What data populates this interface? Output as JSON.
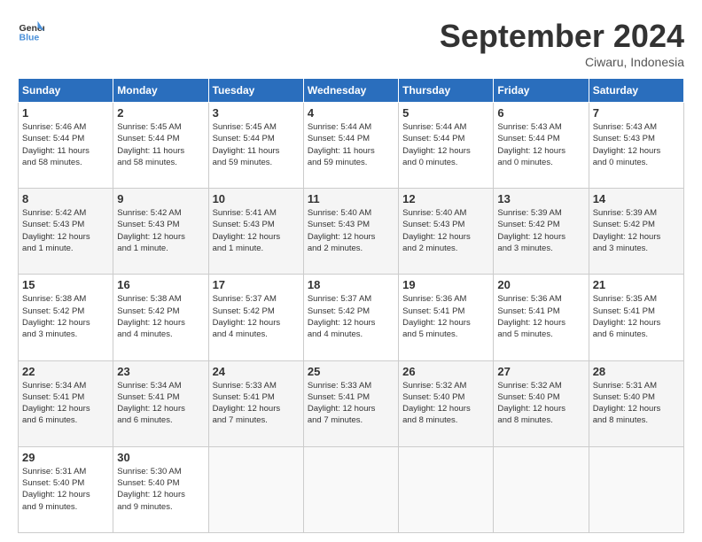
{
  "header": {
    "logo_line1": "General",
    "logo_line2": "Blue",
    "month_title": "September 2024",
    "location": "Ciwaru, Indonesia"
  },
  "weekdays": [
    "Sunday",
    "Monday",
    "Tuesday",
    "Wednesday",
    "Thursday",
    "Friday",
    "Saturday"
  ],
  "weeks": [
    [
      {
        "day": "1",
        "info": "Sunrise: 5:46 AM\nSunset: 5:44 PM\nDaylight: 11 hours\nand 58 minutes."
      },
      {
        "day": "2",
        "info": "Sunrise: 5:45 AM\nSunset: 5:44 PM\nDaylight: 11 hours\nand 58 minutes."
      },
      {
        "day": "3",
        "info": "Sunrise: 5:45 AM\nSunset: 5:44 PM\nDaylight: 11 hours\nand 59 minutes."
      },
      {
        "day": "4",
        "info": "Sunrise: 5:44 AM\nSunset: 5:44 PM\nDaylight: 11 hours\nand 59 minutes."
      },
      {
        "day": "5",
        "info": "Sunrise: 5:44 AM\nSunset: 5:44 PM\nDaylight: 12 hours\nand 0 minutes."
      },
      {
        "day": "6",
        "info": "Sunrise: 5:43 AM\nSunset: 5:44 PM\nDaylight: 12 hours\nand 0 minutes."
      },
      {
        "day": "7",
        "info": "Sunrise: 5:43 AM\nSunset: 5:43 PM\nDaylight: 12 hours\nand 0 minutes."
      }
    ],
    [
      {
        "day": "8",
        "info": "Sunrise: 5:42 AM\nSunset: 5:43 PM\nDaylight: 12 hours\nand 1 minute."
      },
      {
        "day": "9",
        "info": "Sunrise: 5:42 AM\nSunset: 5:43 PM\nDaylight: 12 hours\nand 1 minute."
      },
      {
        "day": "10",
        "info": "Sunrise: 5:41 AM\nSunset: 5:43 PM\nDaylight: 12 hours\nand 1 minute."
      },
      {
        "day": "11",
        "info": "Sunrise: 5:40 AM\nSunset: 5:43 PM\nDaylight: 12 hours\nand 2 minutes."
      },
      {
        "day": "12",
        "info": "Sunrise: 5:40 AM\nSunset: 5:43 PM\nDaylight: 12 hours\nand 2 minutes."
      },
      {
        "day": "13",
        "info": "Sunrise: 5:39 AM\nSunset: 5:42 PM\nDaylight: 12 hours\nand 3 minutes."
      },
      {
        "day": "14",
        "info": "Sunrise: 5:39 AM\nSunset: 5:42 PM\nDaylight: 12 hours\nand 3 minutes."
      }
    ],
    [
      {
        "day": "15",
        "info": "Sunrise: 5:38 AM\nSunset: 5:42 PM\nDaylight: 12 hours\nand 3 minutes."
      },
      {
        "day": "16",
        "info": "Sunrise: 5:38 AM\nSunset: 5:42 PM\nDaylight: 12 hours\nand 4 minutes."
      },
      {
        "day": "17",
        "info": "Sunrise: 5:37 AM\nSunset: 5:42 PM\nDaylight: 12 hours\nand 4 minutes."
      },
      {
        "day": "18",
        "info": "Sunrise: 5:37 AM\nSunset: 5:42 PM\nDaylight: 12 hours\nand 4 minutes."
      },
      {
        "day": "19",
        "info": "Sunrise: 5:36 AM\nSunset: 5:41 PM\nDaylight: 12 hours\nand 5 minutes."
      },
      {
        "day": "20",
        "info": "Sunrise: 5:36 AM\nSunset: 5:41 PM\nDaylight: 12 hours\nand 5 minutes."
      },
      {
        "day": "21",
        "info": "Sunrise: 5:35 AM\nSunset: 5:41 PM\nDaylight: 12 hours\nand 6 minutes."
      }
    ],
    [
      {
        "day": "22",
        "info": "Sunrise: 5:34 AM\nSunset: 5:41 PM\nDaylight: 12 hours\nand 6 minutes."
      },
      {
        "day": "23",
        "info": "Sunrise: 5:34 AM\nSunset: 5:41 PM\nDaylight: 12 hours\nand 6 minutes."
      },
      {
        "day": "24",
        "info": "Sunrise: 5:33 AM\nSunset: 5:41 PM\nDaylight: 12 hours\nand 7 minutes."
      },
      {
        "day": "25",
        "info": "Sunrise: 5:33 AM\nSunset: 5:41 PM\nDaylight: 12 hours\nand 7 minutes."
      },
      {
        "day": "26",
        "info": "Sunrise: 5:32 AM\nSunset: 5:40 PM\nDaylight: 12 hours\nand 8 minutes."
      },
      {
        "day": "27",
        "info": "Sunrise: 5:32 AM\nSunset: 5:40 PM\nDaylight: 12 hours\nand 8 minutes."
      },
      {
        "day": "28",
        "info": "Sunrise: 5:31 AM\nSunset: 5:40 PM\nDaylight: 12 hours\nand 8 minutes."
      }
    ],
    [
      {
        "day": "29",
        "info": "Sunrise: 5:31 AM\nSunset: 5:40 PM\nDaylight: 12 hours\nand 9 minutes."
      },
      {
        "day": "30",
        "info": "Sunrise: 5:30 AM\nSunset: 5:40 PM\nDaylight: 12 hours\nand 9 minutes."
      },
      {
        "day": "",
        "info": ""
      },
      {
        "day": "",
        "info": ""
      },
      {
        "day": "",
        "info": ""
      },
      {
        "day": "",
        "info": ""
      },
      {
        "day": "",
        "info": ""
      }
    ]
  ]
}
